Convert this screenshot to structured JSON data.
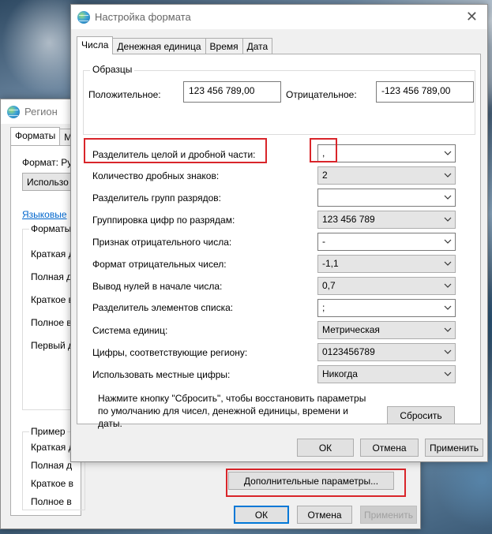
{
  "region": {
    "title": "Регион",
    "tabs": [
      "Форматы",
      "М"
    ],
    "format_label": "Формат: Ру",
    "format_select": "Использо",
    "link": "Языковые",
    "group1_title": "Форматы",
    "group1_rows": [
      "Краткая д",
      "Полная д",
      "Краткое в",
      "Полное в",
      "Первый д"
    ],
    "group2_title": "Пример",
    "group2_rows": [
      "Краткая д",
      "Полная д",
      "Краткое в",
      "Полное в"
    ],
    "advanced_button": "Дополнительные параметры...",
    "ok": "ОК",
    "cancel": "Отмена",
    "apply": "Применить"
  },
  "format": {
    "title": "Настройка формата",
    "tabs": [
      "Числа",
      "Денежная единица",
      "Время",
      "Дата"
    ],
    "samples_title": "Образцы",
    "positive_label": "Положительное:",
    "positive_value": "123 456 789,00",
    "negative_label": "Отрицательное:",
    "negative_value": "-123 456 789,00",
    "rows": [
      {
        "label": "Разделитель целой и дробной части:",
        "value": ","
      },
      {
        "label": "Количество дробных знаков:",
        "value": "2"
      },
      {
        "label": "Разделитель групп разрядов:",
        "value": ""
      },
      {
        "label": "Группировка цифр по разрядам:",
        "value": "123 456 789"
      },
      {
        "label": "Признак отрицательного числа:",
        "value": "-"
      },
      {
        "label": "Формат отрицательных чисел:",
        "value": "-1,1"
      },
      {
        "label": "Вывод нулей в начале числа:",
        "value": "0,7"
      },
      {
        "label": "Разделитель элементов списка:",
        "value": ";"
      },
      {
        "label": "Система единиц:",
        "value": "Метрическая"
      },
      {
        "label": "Цифры, соответствующие региону:",
        "value": "0123456789"
      },
      {
        "label": "Использовать местные цифры:",
        "value": "Никогда"
      }
    ],
    "reset_text": "Нажмите кнопку \"Сбросить\", чтобы восстановить параметры по умолчанию для чисел, денежной единицы, времени и даты.",
    "reset_button": "Сбросить",
    "ok": "ОК",
    "cancel": "Отмена",
    "apply": "Применить"
  }
}
